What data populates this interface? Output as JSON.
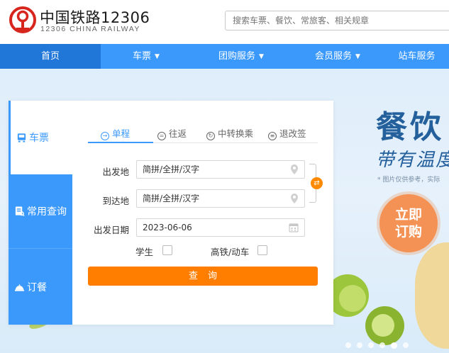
{
  "header": {
    "logo_cn": "中国铁路12306",
    "logo_en": "12306 CHINA RAILWAY",
    "search_placeholder": "搜索车票、餐饮、常旅客、相关规章",
    "brand_color": "#d7261d"
  },
  "nav": {
    "items": [
      {
        "label": "首页",
        "active": true,
        "has_caret": false
      },
      {
        "label": "车票",
        "active": false,
        "has_caret": true
      },
      {
        "label": "团购服务",
        "active": false,
        "has_caret": true
      },
      {
        "label": "会员服务",
        "active": false,
        "has_caret": true
      },
      {
        "label": "站车服务",
        "active": false,
        "has_caret": false
      }
    ],
    "color": "#3b99fc",
    "active_color": "#2077d8"
  },
  "banner": {
    "title": "餐饮",
    "subtitle": "带有温度",
    "note": "* 图片仅供参考，实际",
    "order_button": [
      "立即",
      "订购"
    ],
    "slide_dots": 6,
    "active_dot": 4
  },
  "panel": {
    "side_tabs": [
      {
        "label": "车票",
        "icon": "train-ticket-icon",
        "active": true
      },
      {
        "label": "常用查询",
        "icon": "query-doc-icon",
        "active": false
      },
      {
        "label": "订餐",
        "icon": "dining-bell-icon",
        "active": false
      }
    ],
    "mode_tabs": [
      {
        "label": "单程",
        "glyph": "→",
        "active": true
      },
      {
        "label": "往返",
        "glyph": "=",
        "active": false
      },
      {
        "label": "中转换乘",
        "glyph": "↻",
        "active": false
      },
      {
        "label": "退改签",
        "glyph": "≡",
        "active": false
      }
    ],
    "from_label": "出发地",
    "from_value": "简拼/全拼/汉字",
    "to_label": "到达地",
    "to_value": "简拼/全拼/汉字",
    "date_label": "出发日期",
    "date_value": "2023-06-06",
    "student_label": "学生",
    "student_checked": false,
    "highspeed_label": "高铁/动车",
    "highspeed_checked": false,
    "query_label": "查询",
    "accent_color": "#ff7e00"
  }
}
